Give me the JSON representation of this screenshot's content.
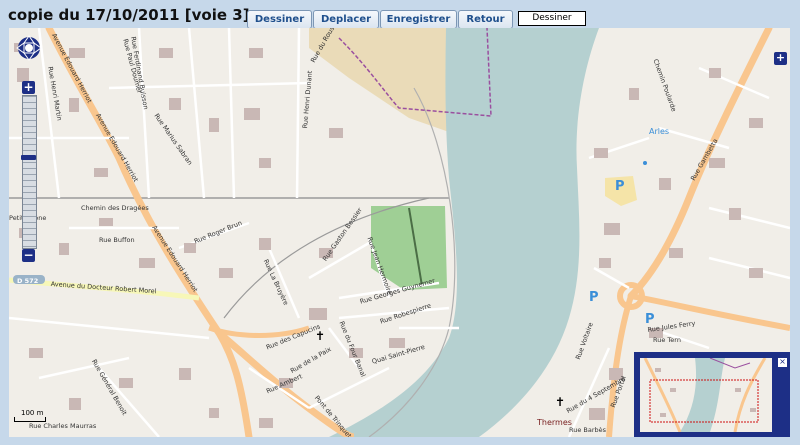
{
  "header": {
    "title": "copie du 17/10/2011 [voie 3]",
    "buttons": {
      "draw": "Dessiner",
      "move": "Deplacer",
      "save": "Enregistrer",
      "back": "Retour"
    },
    "mode_value": "Dessiner"
  },
  "map": {
    "street_labels": {
      "edouard_herriot": "Avenue Edouard Herriot",
      "doumer": "Rue Paul Doumer",
      "henri_martin": "Rue Henri Martin",
      "henri_dunant": "Rue Henri Dunant",
      "marius_sabran": "Rue Marius Sabran",
      "ferdinand_buisson": "Rue Ferdinand Buisson",
      "chemin_dragees": "Chemin des Dragées",
      "buffon": "Rue Buffon",
      "roger_brun": "Rue Roger Brun",
      "robert_morel": "Avenue du Docteur Robert Morel",
      "d572": "D 572",
      "rhone": "Petit Rhône",
      "quai_roubaud": "Quai Saint-Pierre",
      "georges_guynemer": "Rue Georges Guynemer",
      "robespierre": "Rue Robespierre",
      "capucins": "Rue des Capucins",
      "four_banal": "Rue du Four Banal",
      "jean_hermoire": "Rue Jean Hermoire",
      "gaston_bessier": "Rue Gaston Bessier",
      "la_paix": "Rue de la Paix",
      "ambert": "Rue Ambert",
      "gal_benoit": "Rue Général Benoit",
      "charles_maurras": "Rue Charles Maurras",
      "pont_trinquetaille": "Pont de Trinquetaille",
      "jules_ferry": "Rue Jules Ferry",
      "tern": "Rue Tern",
      "barbes": "Rue Barbès",
      "septembre": "Rue du 4 Septembre",
      "voltaire": "Rue Voltaire",
      "portal": "Rue Portal",
      "la_bruyere": "Rue La Bruyère",
      "poularde": "Chemin Poularde",
      "roussillon": "Rue du Roussillon",
      "gambetta": "Rue Gambetta"
    },
    "place_labels": {
      "arles": "Arles",
      "thermes": "Thermes"
    },
    "parking_symbol": "P",
    "scale_text": "100 m",
    "overview_close": "×",
    "expand_symbol": "+",
    "zoom_in_symbol": "+",
    "zoom_out_symbol": "−",
    "colors": {
      "water": "#b5d0d0",
      "land": "#f1eee8",
      "building": "#c9b8b5",
      "trunk_road": "#f9c68e",
      "secondary_road": "#f7f7b8",
      "park": "#9fcf95",
      "sand": "#eadbb8",
      "boundary": "#9a4f9f",
      "panel_blue": "#1d2f86"
    }
  }
}
